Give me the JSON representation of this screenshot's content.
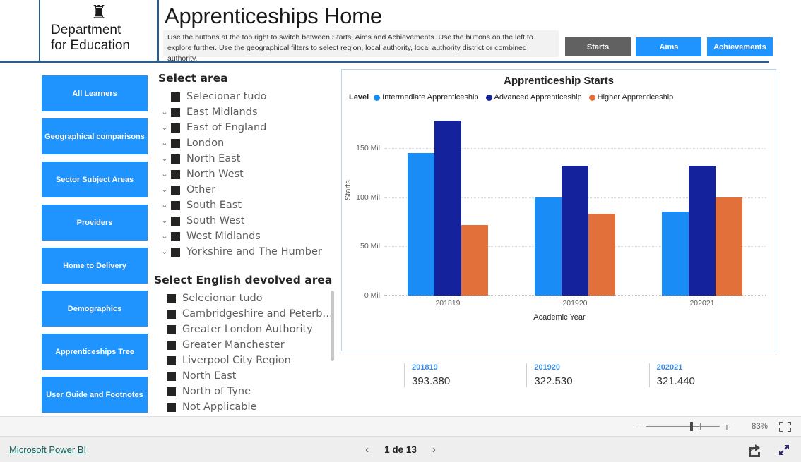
{
  "header": {
    "org_line1": "Department",
    "org_line2": "for Education",
    "crest_glyph": "♜",
    "title": "Apprenticeships Home",
    "description": "Use the buttons at the top right to switch between Starts, Aims and Achievements. Use the buttons on the left to explore further. Use the geographical filters to select region, local authority, local authority district or combined authority.",
    "mode_buttons": [
      {
        "label": "Starts",
        "active": true
      },
      {
        "label": "Aims",
        "active": false
      },
      {
        "label": "Achievements",
        "active": false
      }
    ]
  },
  "sidebar": {
    "items": [
      {
        "label": "All Learners"
      },
      {
        "label": "Geographical comparisons"
      },
      {
        "label": "Sector Subject Areas"
      },
      {
        "label": "Providers"
      },
      {
        "label": "Home to Delivery"
      },
      {
        "label": "Demographics"
      },
      {
        "label": "Apprenticeships Tree"
      },
      {
        "label": "User Guide and Footnotes"
      }
    ]
  },
  "slicers": {
    "area": {
      "title": "Select area",
      "items": [
        {
          "label": "Selecionar tudo",
          "expandable": false
        },
        {
          "label": "East Midlands",
          "expandable": true
        },
        {
          "label": "East of England",
          "expandable": true
        },
        {
          "label": "London",
          "expandable": true
        },
        {
          "label": "North East",
          "expandable": true
        },
        {
          "label": "North West",
          "expandable": true
        },
        {
          "label": "Other",
          "expandable": true
        },
        {
          "label": "South East",
          "expandable": true
        },
        {
          "label": "South West",
          "expandable": true
        },
        {
          "label": "West Midlands",
          "expandable": true
        },
        {
          "label": "Yorkshire and The Humber",
          "expandable": true
        }
      ]
    },
    "devolved": {
      "title": "Select English devolved area",
      "items": [
        {
          "label": "Selecionar tudo",
          "expandable": false
        },
        {
          "label": "Cambridgeshire and Peterborou...",
          "expandable": false
        },
        {
          "label": "Greater London Authority",
          "expandable": false
        },
        {
          "label": "Greater Manchester",
          "expandable": false
        },
        {
          "label": "Liverpool City Region",
          "expandable": false
        },
        {
          "label": "North East",
          "expandable": false
        },
        {
          "label": "North of Tyne",
          "expandable": false
        },
        {
          "label": "Not Applicable",
          "expandable": false
        }
      ]
    }
  },
  "chart_data": {
    "type": "bar",
    "title": "Apprenticeship Starts",
    "legend_label": "Level",
    "legend_position": "top-left",
    "xlabel": "Academic Year",
    "ylabel": "Starts",
    "categories": [
      "201819",
      "201920",
      "202021"
    ],
    "ytick_labels": [
      "0 Mil",
      "50 Mil",
      "100 Mil",
      "150 Mil"
    ],
    "ytick_values": [
      0,
      50,
      100,
      150
    ],
    "ylim": [
      0,
      190
    ],
    "grid": true,
    "series": [
      {
        "name": "Intermediate Apprenticeship",
        "color": "#1a8cf5",
        "values": [
          145,
          100,
          85
        ]
      },
      {
        "name": "Advanced Apprenticeship",
        "color": "#14229b",
        "values": [
          178,
          132,
          132
        ]
      },
      {
        "name": "Higher Apprenticeship",
        "color": "#e2703a",
        "values": [
          72,
          83,
          100
        ]
      }
    ]
  },
  "kpis": [
    {
      "name": "201819",
      "value": "393.380"
    },
    {
      "name": "201920",
      "value": "322.530"
    },
    {
      "name": "202021",
      "value": "321.440"
    }
  ],
  "zoombar": {
    "minus": "−",
    "plus": "+",
    "percent": "83%",
    "fit_icon": "fit-to-page-icon"
  },
  "statusbar": {
    "brand": "Microsoft Power BI",
    "prev_arrow": "‹",
    "next_arrow": "›",
    "page_text": "1 de 13",
    "share_icon": "share-icon",
    "fullscreen_icon": "fullscreen-icon"
  }
}
